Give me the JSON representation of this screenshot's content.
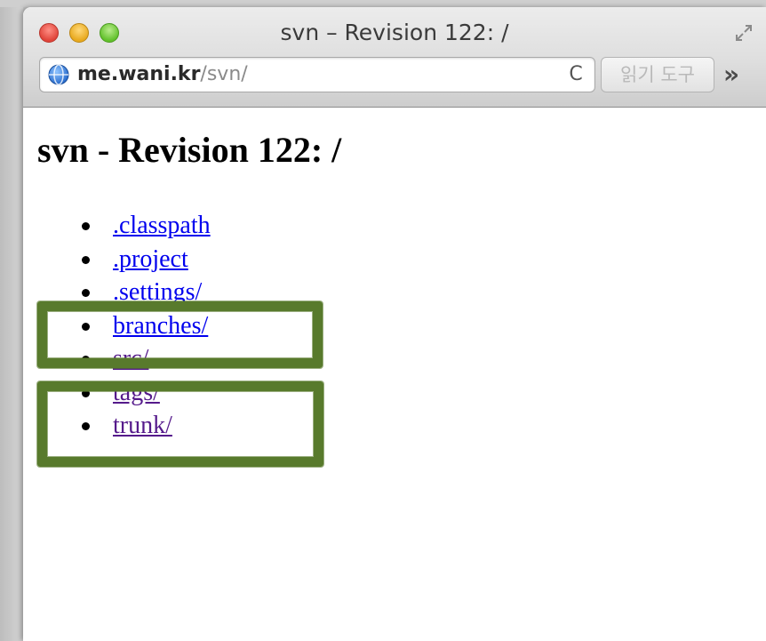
{
  "window": {
    "title": "svn – Revision 122: /"
  },
  "toolbar": {
    "url_host": "me.wani.kr",
    "url_path": "/svn/",
    "reload_glyph": "C",
    "reader_label": "읽기 도구",
    "overflow_glyph": "»"
  },
  "page": {
    "heading": "svn - Revision 122: /",
    "items": [
      {
        "label": ".classpath",
        "visited": false
      },
      {
        "label": ".project",
        "visited": false
      },
      {
        "label": ".settings/",
        "visited": false
      },
      {
        "label": "branches/",
        "visited": false
      },
      {
        "label": "src/",
        "visited": true
      },
      {
        "label": "tags/",
        "visited": true
      },
      {
        "label": "trunk/",
        "visited": true
      }
    ]
  },
  "icons": {
    "globe": "globe-icon",
    "reload": "reload-icon",
    "fullscreen": "fullscreen-icon",
    "overflow": "chevron-double-right-icon"
  },
  "colors": {
    "link": "#0000ee",
    "visited_link": "#551a8b",
    "annotation": "#587a2c",
    "close": "#e0443a",
    "minimize": "#e8a91e",
    "maximize": "#62c12c"
  }
}
